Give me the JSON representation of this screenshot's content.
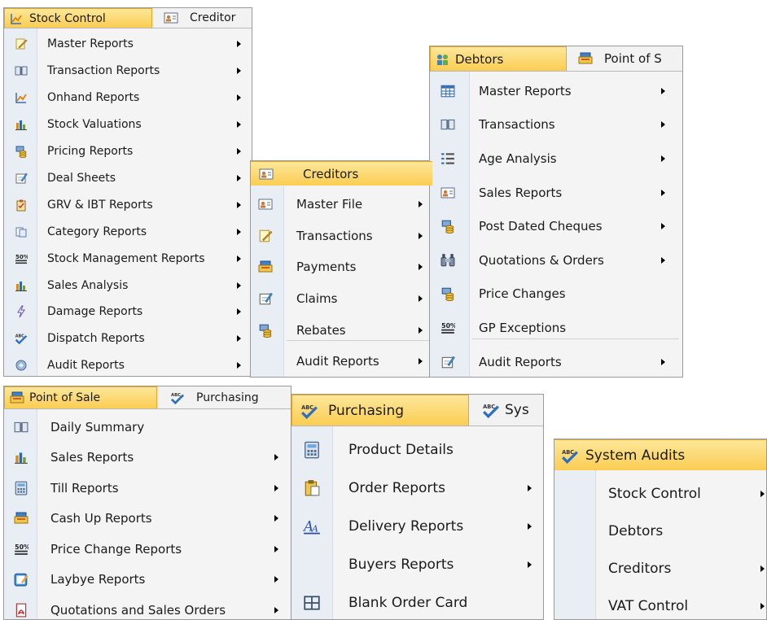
{
  "stock_control": {
    "tabs": [
      "Stock Control",
      "Creditor"
    ],
    "items": [
      {
        "label": "Master Reports",
        "icon": "pencil-note-icon",
        "submenu": true
      },
      {
        "label": "Transaction Reports",
        "icon": "open-book-icon",
        "submenu": true
      },
      {
        "label": "Onhand Reports",
        "icon": "line-chart-icon",
        "submenu": true
      },
      {
        "label": "Stock Valuations",
        "icon": "bar-chart-icon",
        "submenu": true
      },
      {
        "label": "Pricing Reports",
        "icon": "coins-icon",
        "submenu": true
      },
      {
        "label": "Deal Sheets",
        "icon": "edit-sheet-icon",
        "submenu": true
      },
      {
        "label": "GRV & IBT Reports",
        "icon": "clipboard-check-icon",
        "submenu": true
      },
      {
        "label": "Category Reports",
        "icon": "copy-pages-icon",
        "submenu": true
      },
      {
        "label": "Stock Management Reports",
        "icon": "percent-icon",
        "submenu": true
      },
      {
        "label": "Sales Analysis",
        "icon": "bar-chart-icon",
        "submenu": true
      },
      {
        "label": "Damage Reports",
        "icon": "lightning-icon",
        "submenu": true
      },
      {
        "label": "Dispatch Reports",
        "icon": "abc-check-icon",
        "submenu": true
      },
      {
        "label": "Audit Reports",
        "icon": "shield-icon",
        "submenu": true
      }
    ]
  },
  "creditors": {
    "title": "Creditors",
    "items": [
      {
        "label": "Master File",
        "icon": "id-card-icon",
        "submenu": true
      },
      {
        "label": "Transactions",
        "icon": "pencil-note-icon",
        "submenu": true
      },
      {
        "label": "Payments",
        "icon": "cash-register-icon",
        "submenu": true
      },
      {
        "label": "Claims",
        "icon": "edit-sheet-icon",
        "submenu": true
      },
      {
        "label": "Rebates",
        "icon": "coins-icon",
        "submenu": true
      },
      {
        "label": "Audit Reports",
        "icon": "none",
        "submenu": true
      }
    ]
  },
  "debtors": {
    "tabs": [
      "Debtors",
      "Point of S"
    ],
    "items": [
      {
        "label": "Master Reports",
        "icon": "table-icon",
        "submenu": true
      },
      {
        "label": "Transactions",
        "icon": "open-book-icon",
        "submenu": true
      },
      {
        "label": "Age Analysis",
        "icon": "list-icon",
        "submenu": true
      },
      {
        "label": "Sales Reports",
        "icon": "id-card-icon",
        "submenu": true
      },
      {
        "label": "Post Dated Cheques",
        "icon": "coins-icon",
        "submenu": true
      },
      {
        "label": "Quotations & Orders",
        "icon": "binoculars-icon",
        "submenu": true
      },
      {
        "label": "Price Changes",
        "icon": "coins-icon",
        "submenu": false
      },
      {
        "label": "GP Exceptions",
        "icon": "percent-icon",
        "submenu": false
      },
      {
        "label": "Audit Reports",
        "icon": "edit-sheet-icon",
        "submenu": true
      }
    ]
  },
  "point_of_sale": {
    "tabs": [
      "Point of Sale",
      "Purchasing"
    ],
    "items": [
      {
        "label": "Daily Summary",
        "icon": "open-book-icon",
        "submenu": false
      },
      {
        "label": "Sales Reports",
        "icon": "bar-chart-icon",
        "submenu": true
      },
      {
        "label": "Till Reports",
        "icon": "calculator-icon",
        "submenu": true
      },
      {
        "label": "Cash Up Reports",
        "icon": "cash-register-icon",
        "submenu": true
      },
      {
        "label": "Price Change Reports",
        "icon": "percent-icon",
        "submenu": true
      },
      {
        "label": "Laybye Reports",
        "icon": "notepad-icon",
        "submenu": true
      },
      {
        "label": "Quotations and Sales Orders",
        "icon": "pdf-icon",
        "submenu": true
      }
    ]
  },
  "purchasing": {
    "tabs": [
      "Purchasing",
      "Sys"
    ],
    "items": [
      {
        "label": "Product Details",
        "icon": "calculator-icon",
        "submenu": false
      },
      {
        "label": "Order Reports",
        "icon": "clipboard-icon",
        "submenu": true
      },
      {
        "label": "Delivery Reports",
        "icon": "font-a-icon",
        "submenu": true
      },
      {
        "label": "Buyers Reports",
        "icon": "none",
        "submenu": true
      },
      {
        "label": "Blank Order Card",
        "icon": "grid-icon",
        "submenu": false
      }
    ]
  },
  "system_audits": {
    "title": "System Audits",
    "items": [
      {
        "label": "Stock Control",
        "submenu": true
      },
      {
        "label": "Debtors",
        "submenu": false
      },
      {
        "label": "Creditors",
        "submenu": true
      },
      {
        "label": "VAT Control",
        "submenu": true
      }
    ]
  },
  "colors": {
    "active_tab_top": "#fde79a",
    "active_tab_bottom": "#fbcd52",
    "gutter": "#e9eef5",
    "menu_bg": "#f4f4f4"
  }
}
